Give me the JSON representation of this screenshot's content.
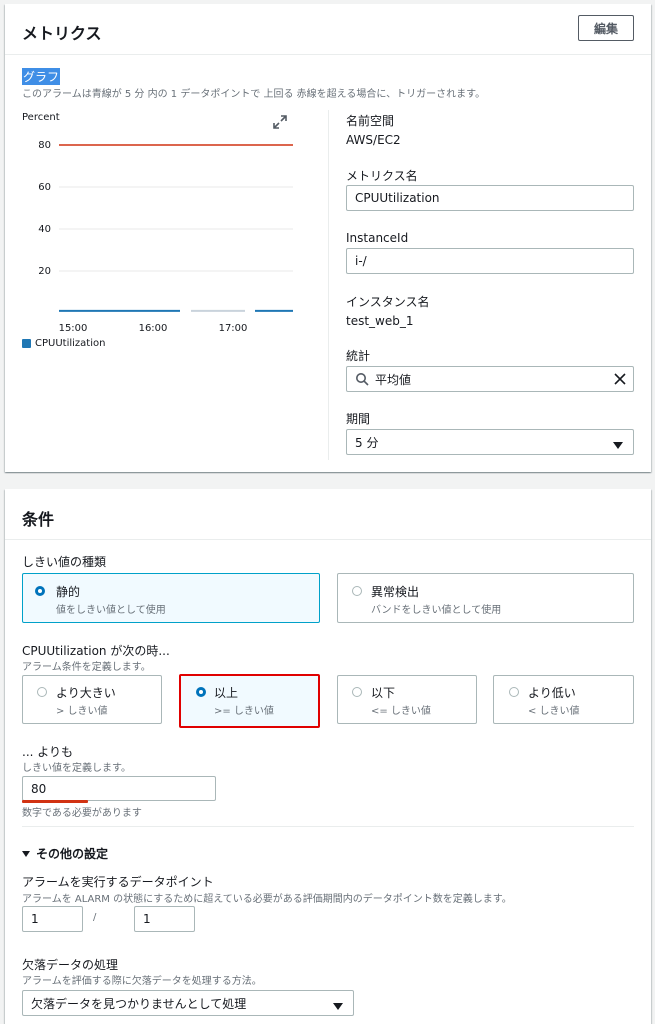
{
  "metrics": {
    "title": "メトリクス",
    "edit_label": "編集",
    "graph_label": "グラフ",
    "graph_desc": "このアラームは青線が 5 分 内の 1 データポイントで 上回る 赤線を超える場合に、トリガーされます。",
    "chart_unit": "Percent",
    "y_ticks": [
      "80",
      "60",
      "40",
      "20"
    ],
    "x_ticks": [
      "15:00",
      "16:00",
      "17:00"
    ],
    "legend": "CPUUtilization",
    "colors": {
      "threshold": "#d13212",
      "series": "#1f77b4"
    },
    "fields": {
      "namespace_label": "名前空間",
      "namespace_value": "AWS/EC2",
      "metric_name_label": "メトリクス名",
      "metric_name_value": "CPUUtilization",
      "instance_id_label": "InstanceId",
      "instance_id_value": "i-/",
      "instance_name_label": "インスタンス名",
      "instance_name_value": "test_web_1",
      "statistic_label": "統計",
      "statistic_value": "平均値",
      "period_label": "期間",
      "period_value": "5 分"
    }
  },
  "chart_data": {
    "type": "line",
    "x": [
      "15:00",
      "16:00",
      "17:00"
    ],
    "ylabel": "Percent",
    "ylim": [
      0,
      80
    ],
    "series": [
      {
        "name": "CPUUtilization",
        "values": [
          1,
          1,
          1
        ]
      }
    ],
    "threshold": 80,
    "grid": true,
    "legend": "bottom-left"
  },
  "conditions": {
    "title": "条件",
    "threshold_type_label": "しきい値の種類",
    "static_title": "静的",
    "static_desc": "値をしきい値として使用",
    "anomaly_title": "異常検出",
    "anomaly_desc": "バンドをしきい値として使用",
    "when_label": "CPUUtilization が次の時...",
    "when_desc": "アラーム条件を定義します。",
    "options": [
      {
        "title": "より大きい",
        "desc": "> しきい値"
      },
      {
        "title": "以上",
        "desc": ">= しきい値"
      },
      {
        "title": "以下",
        "desc": "<= しきい値"
      },
      {
        "title": "より低い",
        "desc": "< しきい値"
      }
    ],
    "than_label": "... よりも",
    "than_desc": "しきい値を定義します。",
    "threshold_value": "80",
    "threshold_hint": "数字である必要があります",
    "other_settings": "その他の設定",
    "datapoints_label": "アラームを実行するデータポイント",
    "datapoints_desc": "アラームを ALARM の状態にするために超えている必要がある評価期間内のデータポイント数を定義します。",
    "datapoints_m": "1",
    "datapoints_sep": "/",
    "datapoints_n": "1",
    "missing_label": "欠落データの処理",
    "missing_desc": "アラームを評価する際に欠落データを処理する方法。",
    "missing_value": "欠落データを見つかりませんとして処理"
  }
}
